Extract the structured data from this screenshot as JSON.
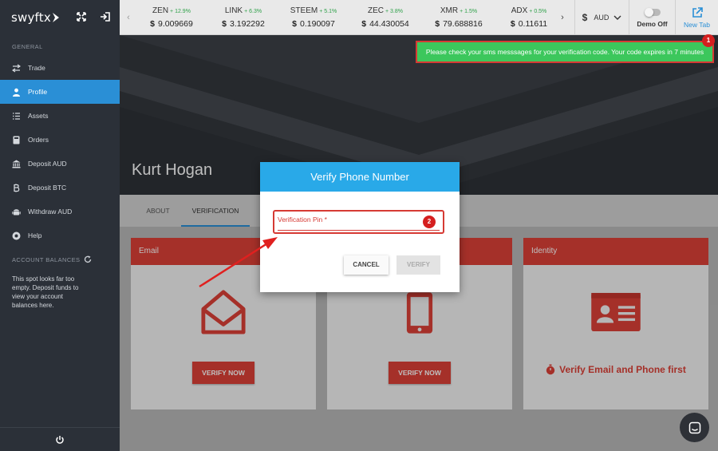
{
  "brand": {
    "name": "swyftx"
  },
  "sidebar": {
    "general_label": "GENERAL",
    "items": [
      {
        "label": "Trade",
        "icon": "swap-icon",
        "active": false
      },
      {
        "label": "Profile",
        "icon": "user-icon",
        "active": true
      },
      {
        "label": "Assets",
        "icon": "list-icon",
        "active": false
      },
      {
        "label": "Orders",
        "icon": "calculator-icon",
        "active": false
      },
      {
        "label": "Deposit AUD",
        "icon": "bank-icon",
        "active": false
      },
      {
        "label": "Deposit BTC",
        "icon": "bitcoin-icon",
        "active": false
      },
      {
        "label": "Withdraw AUD",
        "icon": "android-icon",
        "active": false
      },
      {
        "label": "Help",
        "icon": "help-icon",
        "active": false
      }
    ],
    "balances_label": "ACCOUNT BALANCES",
    "empty_message": "This spot looks far too empty. Deposit funds to view your account balances here."
  },
  "tickers": [
    {
      "symbol": "ZEN",
      "change": "+ 12.9%",
      "currency_sign": "$",
      "price": "9.009669"
    },
    {
      "symbol": "LINK",
      "change": "+ 6.3%",
      "currency_sign": "$",
      "price": "3.192292"
    },
    {
      "symbol": "STEEM",
      "change": "+ 5.1%",
      "currency_sign": "$",
      "price": "0.190097"
    },
    {
      "symbol": "ZEC",
      "change": "+ 3.8%",
      "currency_sign": "$",
      "price": "44.430054"
    },
    {
      "symbol": "XMR",
      "change": "+ 1.5%",
      "currency_sign": "$",
      "price": "79.688816"
    },
    {
      "symbol": "ADX",
      "change": "+ 0.5%",
      "currency_sign": "$",
      "price": "0.11611"
    }
  ],
  "topbar": {
    "currency_sign": "$",
    "currency": "AUD",
    "demo_label": "Demo Off",
    "new_tab_label": "New Tab"
  },
  "toast": {
    "message": "Please check your sms messsages for your verification code. Your code expires in 7 minutes",
    "badge": "1"
  },
  "profile": {
    "name": "Kurt Hogan"
  },
  "tabs": [
    {
      "label": "ABOUT",
      "active": false
    },
    {
      "label": "VERIFICATION",
      "active": true
    }
  ],
  "cards": {
    "email": {
      "title": "Email",
      "button": "VERIFY NOW"
    },
    "phone": {
      "title": "",
      "button": "VERIFY NOW"
    },
    "identity": {
      "title": "Identity",
      "notice": "Verify Email and Phone first"
    }
  },
  "modal": {
    "title": "Verify Phone Number",
    "pin_label": "Verification Pin *",
    "pin_value": "",
    "cancel_label": "CANCEL",
    "verify_label": "VERIFY",
    "badge": "2"
  },
  "colors": {
    "sidebar_bg": "#2b3038",
    "accent_blue": "#2a8fd6",
    "modal_header": "#29a9e8",
    "card_red": "#dc4137",
    "toast_green": "#3cc75c",
    "positive_change": "#2fa14a"
  }
}
